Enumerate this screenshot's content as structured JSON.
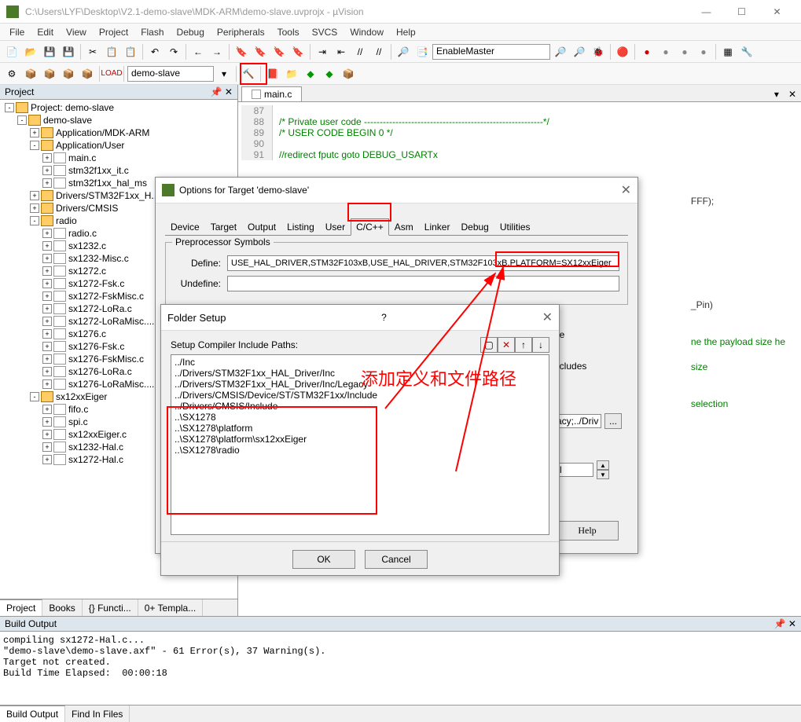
{
  "window": {
    "title": "C:\\Users\\LYF\\Desktop\\V2.1-demo-slave\\MDK-ARM\\demo-slave.uvprojx - µVision",
    "min": "—",
    "max": "☐",
    "close": "✕"
  },
  "menu": [
    "File",
    "Edit",
    "View",
    "Project",
    "Flash",
    "Debug",
    "Peripherals",
    "Tools",
    "SVCS",
    "Window",
    "Help"
  ],
  "toolbar2_target": "demo-slave",
  "combo_text": "EnableMaster",
  "project_panel_title": "Project",
  "tree": [
    {
      "d": 0,
      "exp": "-",
      "icon": "folder",
      "label": "Project: demo-slave",
      "name": "proj-root"
    },
    {
      "d": 1,
      "exp": "-",
      "icon": "folder",
      "label": "demo-slave",
      "name": "target"
    },
    {
      "d": 2,
      "exp": "+",
      "icon": "folder",
      "label": "Application/MDK-ARM",
      "name": "grp-mdkarm"
    },
    {
      "d": 2,
      "exp": "-",
      "icon": "folder",
      "label": "Application/User",
      "name": "grp-user"
    },
    {
      "d": 3,
      "exp": "+",
      "icon": "file",
      "label": "main.c",
      "name": "file-main"
    },
    {
      "d": 3,
      "exp": "+",
      "icon": "file",
      "label": "stm32f1xx_it.c",
      "name": "file-it"
    },
    {
      "d": 3,
      "exp": "+",
      "icon": "file",
      "label": "stm32f1xx_hal_ms",
      "name": "file-halms"
    },
    {
      "d": 2,
      "exp": "+",
      "icon": "folder",
      "label": "Drivers/STM32F1xx_H...",
      "name": "grp-hal"
    },
    {
      "d": 2,
      "exp": "+",
      "icon": "folder",
      "label": "Drivers/CMSIS",
      "name": "grp-cmsis"
    },
    {
      "d": 2,
      "exp": "-",
      "icon": "folder",
      "label": "radio",
      "name": "grp-radio"
    },
    {
      "d": 3,
      "exp": "+",
      "icon": "file",
      "label": "radio.c",
      "name": "file-radio"
    },
    {
      "d": 3,
      "exp": "+",
      "icon": "file",
      "label": "sx1232.c",
      "name": "file-sx1232"
    },
    {
      "d": 3,
      "exp": "+",
      "icon": "file",
      "label": "sx1232-Misc.c",
      "name": "file-sx1232misc"
    },
    {
      "d": 3,
      "exp": "+",
      "icon": "file",
      "label": "sx1272.c",
      "name": "file-sx1272"
    },
    {
      "d": 3,
      "exp": "+",
      "icon": "file",
      "label": "sx1272-Fsk.c",
      "name": "file-sx1272fsk"
    },
    {
      "d": 3,
      "exp": "+",
      "icon": "file",
      "label": "sx1272-FskMisc.c",
      "name": "file-sx1272fskmisc"
    },
    {
      "d": 3,
      "exp": "+",
      "icon": "file",
      "label": "sx1272-LoRa.c",
      "name": "file-sx1272lora"
    },
    {
      "d": 3,
      "exp": "+",
      "icon": "file",
      "label": "sx1272-LoRaMisc....",
      "name": "file-sx1272loramisc"
    },
    {
      "d": 3,
      "exp": "+",
      "icon": "file",
      "label": "sx1276.c",
      "name": "file-sx1276"
    },
    {
      "d": 3,
      "exp": "+",
      "icon": "file",
      "label": "sx1276-Fsk.c",
      "name": "file-sx1276fsk"
    },
    {
      "d": 3,
      "exp": "+",
      "icon": "file",
      "label": "sx1276-FskMisc.c",
      "name": "file-sx1276fskmisc"
    },
    {
      "d": 3,
      "exp": "+",
      "icon": "file",
      "label": "sx1276-LoRa.c",
      "name": "file-sx1276lora"
    },
    {
      "d": 3,
      "exp": "+",
      "icon": "file",
      "label": "sx1276-LoRaMisc....",
      "name": "file-sx1276loramisc"
    },
    {
      "d": 2,
      "exp": "-",
      "icon": "folder",
      "label": "sx12xxEiger",
      "name": "grp-eiger"
    },
    {
      "d": 3,
      "exp": "+",
      "icon": "file",
      "label": "fifo.c",
      "name": "file-fifo"
    },
    {
      "d": 3,
      "exp": "+",
      "icon": "file",
      "label": "spi.c",
      "name": "file-spi"
    },
    {
      "d": 3,
      "exp": "+",
      "icon": "file",
      "label": "sx12xxEiger.c",
      "name": "file-sx12xxeiger"
    },
    {
      "d": 3,
      "exp": "+",
      "icon": "file",
      "label": "sx1232-Hal.c",
      "name": "file-sx1232hal"
    },
    {
      "d": 3,
      "exp": "+",
      "icon": "file",
      "label": "sx1272-Hal.c",
      "name": "file-sx1272hal"
    }
  ],
  "bottom_tabs": [
    "Project",
    "Books",
    "{} Functi...",
    "0+ Templa..."
  ],
  "editor_tab": "main.c",
  "code_lines": [
    {
      "n": 87,
      "t": ""
    },
    {
      "n": 88,
      "t": "/* Private user code ---------------------------------------------------------*/",
      "c": "comment"
    },
    {
      "n": 89,
      "t": "/* USER CODE BEGIN 0 */",
      "c": "comment"
    },
    {
      "n": 90,
      "t": ""
    },
    {
      "n": 91,
      "t": "//redirect fputc goto DEBUG_USARTx",
      "c": "comment"
    }
  ],
  "code_frag_right": [
    "FFF);",
    "_Pin)",
    "ne the payload size he",
    " size",
    " selection",
    "-l"
  ],
  "code_frag_right_labels": [
    "de",
    "ncludes",
    "acy;../Driv"
  ],
  "options_dialog": {
    "title": "Options for Target 'demo-slave'",
    "tabs": [
      "Device",
      "Target",
      "Output",
      "Listing",
      "User",
      "C/C++",
      "Asm",
      "Linker",
      "Debug",
      "Utilities"
    ],
    "active_tab": "C/C++",
    "group_title": "Preprocessor Symbols",
    "define_label": "Define:",
    "define_value": "USE_HAL_DRIVER,STM32F103xB,USE_HAL_DRIVER,STM32F103xB,PLATFORM=SX12xxEiger",
    "undefine_label": "Undefine:",
    "undefine_value": "",
    "help": "Help"
  },
  "folder_dialog": {
    "title": "Folder Setup",
    "list_title": "Setup Compiler Include Paths:",
    "paths": [
      "../Inc",
      "../Drivers/STM32F1xx_HAL_Driver/Inc",
      "../Drivers/STM32F1xx_HAL_Driver/Inc/Legacy",
      "../Drivers/CMSIS/Device/ST/STM32F1xx/Include",
      "../Drivers/CMSIS/Include",
      "..\\SX1278",
      "..\\SX1278\\platform",
      "..\\SX1278\\platform\\sx12xxEiger",
      "..\\SX1278\\radio"
    ],
    "ok": "OK",
    "cancel": "Cancel"
  },
  "annotation": "添加定义和文件路径",
  "build": {
    "title": "Build Output",
    "lines": [
      "compiling sx1272-Hal.c...",
      "\"demo-slave\\demo-slave.axf\" - 61 Error(s), 37 Warning(s).",
      "Target not created.",
      "Build Time Elapsed:  00:00:18"
    ],
    "tabs": [
      "Build Output",
      "Find In Files"
    ]
  }
}
